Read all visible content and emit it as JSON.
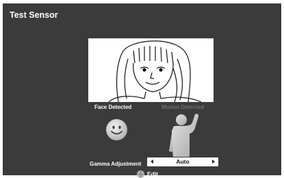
{
  "window": {
    "title": "Test Sensor"
  },
  "detection": {
    "face_label": "Face Detected",
    "motion_label": "Motion Detected",
    "face_active": true,
    "motion_active": false
  },
  "gamma": {
    "label": "Gamma Adjustment",
    "value": "Auto"
  },
  "footer": {
    "edit_label": "Edit",
    "edit_icon": "dpad-icon"
  },
  "colors": {
    "background": "#3b3b3b",
    "text": "#ffffff",
    "inactive_text": "#6e6e6e",
    "icon_active": "#d4d4d4",
    "icon_inactive": "#c9c9c9"
  }
}
